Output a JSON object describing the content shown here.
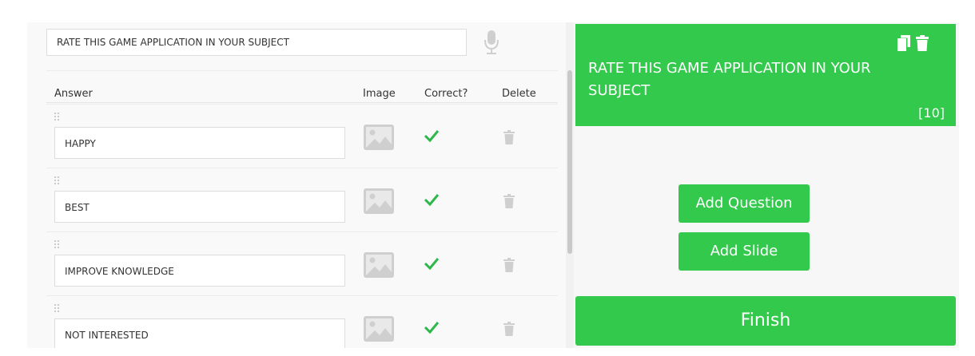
{
  "question": {
    "text": "RATE THIS GAME APPLICATION IN YOUR SUBJECT"
  },
  "table": {
    "headers": [
      "Answer",
      "Image",
      "Correct?",
      "Delete"
    ],
    "rows": [
      {
        "answer": "HAPPY",
        "correct": true
      },
      {
        "answer": "BEST",
        "correct": true
      },
      {
        "answer": "IMPROVE KNOWLEDGE",
        "correct": true
      },
      {
        "answer": "NOT INTERESTED",
        "correct": true
      }
    ]
  },
  "card": {
    "title": "RATE THIS GAME APPLICATION IN YOUR SUBJECT",
    "points": "[10]"
  },
  "actions": {
    "add_question": "Add Question",
    "add_slide": "Add Slide",
    "finish": "Finish"
  },
  "colors": {
    "accent": "#33c94c",
    "check": "#2db84a",
    "muted_icon": "#cfcfcf"
  },
  "icons": [
    "microphone-icon",
    "drag-handle-icon",
    "image-icon",
    "checkmark-icon",
    "trash-icon",
    "copy-icon"
  ]
}
